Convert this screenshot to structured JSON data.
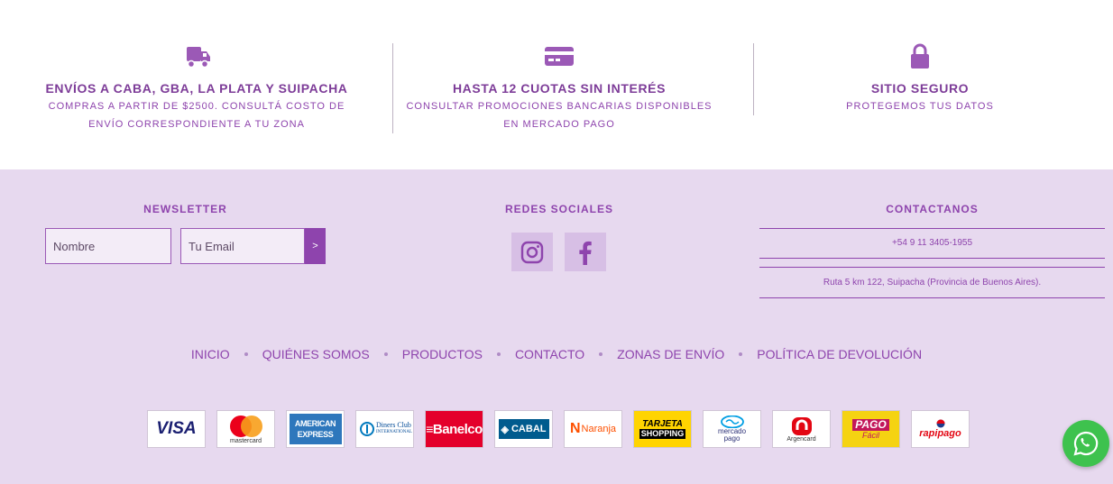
{
  "benefits": [
    {
      "icon": "truck-icon",
      "title": "ENVÍOS A CABA, GBA, LA PLATA Y SUIPACHA",
      "desc1": "COMPRAS A PARTIR DE $2500. CONSULTÁ COSTO DE",
      "desc2": "ENVÍO CORRESPONDIENTE A TU ZONA"
    },
    {
      "icon": "credit-card-icon",
      "title": "HASTA 12 CUOTAS SIN INTERÉS",
      "desc1": "CONSULTAR PROMOCIONES BANCARIAS DISPONIBLES",
      "desc2": "EN MERCADO PAGO"
    },
    {
      "icon": "lock-icon",
      "title": "SITIO SEGURO",
      "desc1": "PROTEGEMOS TUS DATOS"
    }
  ],
  "newsletter": {
    "heading": "NEWSLETTER",
    "name_placeholder": "Nombre",
    "email_placeholder": "Tu Email",
    "submit_label": ">"
  },
  "social": {
    "heading": "REDES SOCIALES",
    "links": [
      "instagram-icon",
      "facebook-icon"
    ]
  },
  "contact": {
    "heading": "CONTACTANOS",
    "phone": "+54 9 11 3405-1955",
    "address": "Ruta 5 km 122, Suipacha (Provincia de Buenos Aires)."
  },
  "menu": [
    "INICIO",
    "QUIÉNES SOMOS",
    "PRODUCTOS",
    "CONTACTO",
    "ZONAS DE ENVÍO",
    "POLÍTICA DE DEVOLUCIÓN"
  ],
  "payments": {
    "visa": "VISA",
    "mastercard": "mastercard",
    "amex1": "AMERICAN",
    "amex2": "EXPRESS",
    "diners1": "Diners Club",
    "diners2": "INTERNATIONAL",
    "banelco": "Banelco",
    "cabal": "CABAL",
    "naranja": "Naranja",
    "tarjeta1": "TARJETA",
    "tarjeta2": "SHOPPING",
    "mercado1": "mercado",
    "mercado2": "pago",
    "argencard": "Argencard",
    "pagofacil1": "PAGO",
    "pagofacil2": "Fácil",
    "rapipago": "rapipago"
  },
  "colors": {
    "accent": "#8e44ad",
    "footer_bg": "#e7d9ef",
    "whatsapp": "#3ec24e"
  },
  "whatsapp_icon": "whatsapp-icon"
}
